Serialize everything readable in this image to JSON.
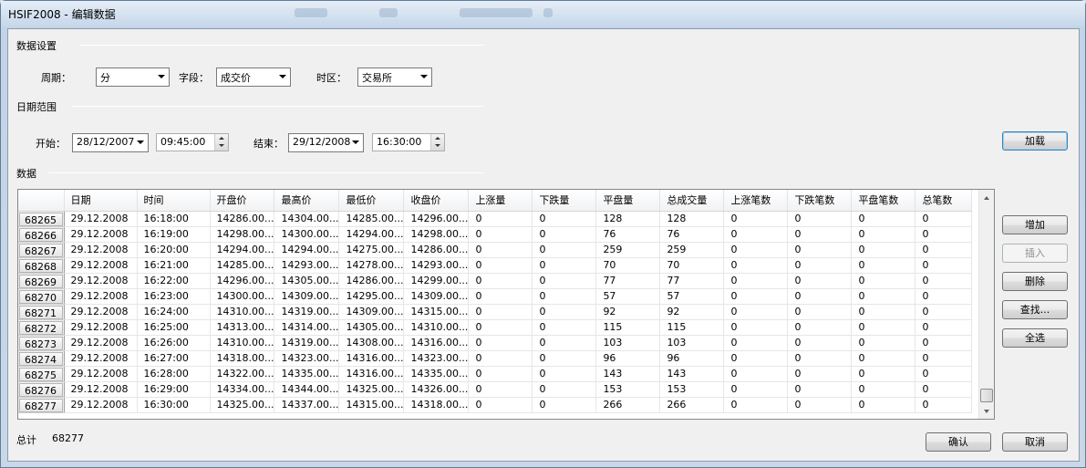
{
  "window": {
    "title": "HSIF2008 - 编辑数据"
  },
  "settings": {
    "group_label": "数据设置",
    "period_label": "周期：",
    "period_value": "分",
    "field_label": "字段：",
    "field_value": "成交价",
    "timezone_label": "时区：",
    "timezone_value": "交易所"
  },
  "date_range": {
    "group_label": "日期范围",
    "start_label": "开始：",
    "start_date": "28/12/2007",
    "start_time": "09:45:00",
    "end_label": "结束：",
    "end_date": "29/12/2008",
    "end_time": "16:30:00"
  },
  "buttons": {
    "load": "加载",
    "add": "增加",
    "insert": "插入",
    "delete": "删除",
    "find": "查找...",
    "select_all": "全选",
    "ok": "确认",
    "cancel": "取消"
  },
  "data_section": {
    "group_label": "数据"
  },
  "table": {
    "columns": [
      "日期",
      "时间",
      "开盘价",
      "最高价",
      "最低价",
      "收盘价",
      "上涨量",
      "下跌量",
      "平盘量",
      "总成交量",
      "上涨笔数",
      "下跌笔数",
      "平盘笔数",
      "总笔数"
    ],
    "rows": [
      [
        "68265",
        "29.12.2008",
        "16:18:00",
        "14286.00...",
        "14304.00...",
        "14285.00...",
        "14296.00...",
        "0",
        "0",
        "128",
        "128",
        "0",
        "0",
        "0",
        "0"
      ],
      [
        "68266",
        "29.12.2008",
        "16:19:00",
        "14298.00...",
        "14300.00...",
        "14294.00...",
        "14298.00...",
        "0",
        "0",
        "76",
        "76",
        "0",
        "0",
        "0",
        "0"
      ],
      [
        "68267",
        "29.12.2008",
        "16:20:00",
        "14294.00...",
        "14294.00...",
        "14275.00...",
        "14286.00...",
        "0",
        "0",
        "259",
        "259",
        "0",
        "0",
        "0",
        "0"
      ],
      [
        "68268",
        "29.12.2008",
        "16:21:00",
        "14285.00...",
        "14293.00...",
        "14278.00...",
        "14293.00...",
        "0",
        "0",
        "70",
        "70",
        "0",
        "0",
        "0",
        "0"
      ],
      [
        "68269",
        "29.12.2008",
        "16:22:00",
        "14296.00...",
        "14305.00...",
        "14286.00...",
        "14299.00...",
        "0",
        "0",
        "77",
        "77",
        "0",
        "0",
        "0",
        "0"
      ],
      [
        "68270",
        "29.12.2008",
        "16:23:00",
        "14300.00...",
        "14309.00...",
        "14295.00...",
        "14309.00...",
        "0",
        "0",
        "57",
        "57",
        "0",
        "0",
        "0",
        "0"
      ],
      [
        "68271",
        "29.12.2008",
        "16:24:00",
        "14310.00...",
        "14319.00...",
        "14309.00...",
        "14315.00...",
        "0",
        "0",
        "92",
        "92",
        "0",
        "0",
        "0",
        "0"
      ],
      [
        "68272",
        "29.12.2008",
        "16:25:00",
        "14313.00...",
        "14314.00...",
        "14305.00...",
        "14310.00...",
        "0",
        "0",
        "115",
        "115",
        "0",
        "0",
        "0",
        "0"
      ],
      [
        "68273",
        "29.12.2008",
        "16:26:00",
        "14310.00...",
        "14319.00...",
        "14308.00...",
        "14316.00...",
        "0",
        "0",
        "103",
        "103",
        "0",
        "0",
        "0",
        "0"
      ],
      [
        "68274",
        "29.12.2008",
        "16:27:00",
        "14318.00...",
        "14323.00...",
        "14316.00...",
        "14323.00...",
        "0",
        "0",
        "96",
        "96",
        "0",
        "0",
        "0",
        "0"
      ],
      [
        "68275",
        "29.12.2008",
        "16:28:00",
        "14322.00...",
        "14335.00...",
        "14316.00...",
        "14335.00...",
        "0",
        "0",
        "143",
        "143",
        "0",
        "0",
        "0",
        "0"
      ],
      [
        "68276",
        "29.12.2008",
        "16:29:00",
        "14334.00...",
        "14344.00...",
        "14325.00...",
        "14326.00...",
        "0",
        "0",
        "153",
        "153",
        "0",
        "0",
        "0",
        "0"
      ],
      [
        "68277",
        "29.12.2008",
        "16:30:00",
        "14325.00...",
        "14337.00...",
        "14315.00...",
        "14318.00...",
        "0",
        "0",
        "266",
        "266",
        "0",
        "0",
        "0",
        "0"
      ]
    ]
  },
  "footer": {
    "total_label": "总计",
    "total_value": "68277"
  }
}
